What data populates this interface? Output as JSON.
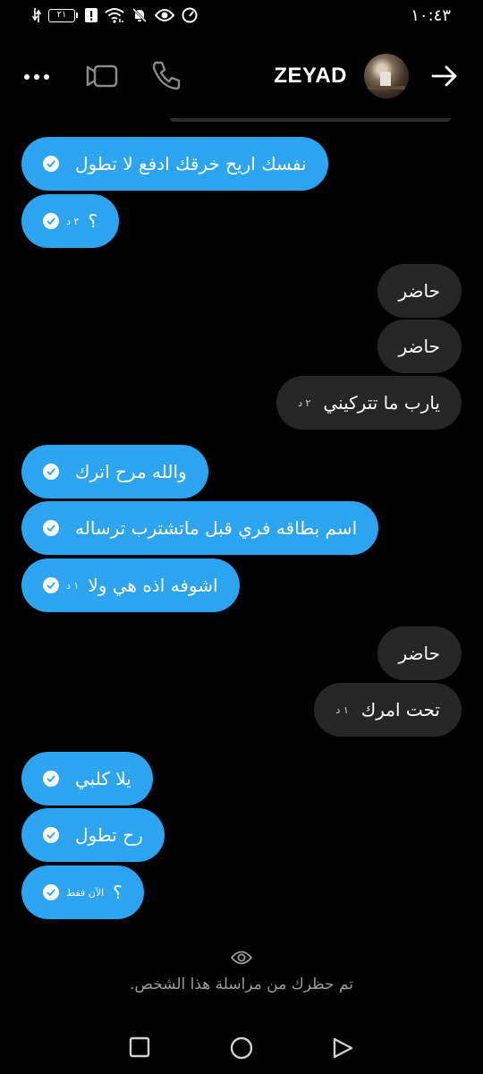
{
  "status_bar": {
    "time": "١٠:٤٣",
    "battery": "٢١",
    "icons": [
      "charging-arrows-icon",
      "battery-icon",
      "alert-icon",
      "wifi-icon",
      "muted-bell-icon",
      "eye-icon",
      "speedometer-icon"
    ]
  },
  "header": {
    "contact_name": "ZEYAD",
    "icons": [
      "more-icon",
      "video-call-icon",
      "voice-call-icon",
      "avatar",
      "back-arrow-icon"
    ]
  },
  "messages": [
    {
      "side": "sent",
      "text": "نفسك اريح خرقك ادفع لا تطول",
      "time": "",
      "read": true
    },
    {
      "side": "sent",
      "text": "؟",
      "time": "٢ د",
      "read": true
    },
    {
      "side": "received",
      "text": "حاضر",
      "time": ""
    },
    {
      "side": "received",
      "text": "حاضر",
      "time": ""
    },
    {
      "side": "received",
      "text": "يارب ما تتركيني",
      "time": "٢ د"
    },
    {
      "side": "sent",
      "text": "والله مرح اترك",
      "time": "",
      "read": true
    },
    {
      "side": "sent",
      "text": "اسم بطاقه فري قبل ماتشترب ترساله",
      "time": "",
      "read": true
    },
    {
      "side": "sent",
      "text": "اشوفه اذه هي ولا",
      "time": "١ د",
      "read": true
    },
    {
      "side": "received",
      "text": "حاضر",
      "time": ""
    },
    {
      "side": "received",
      "text": "تحت امرك",
      "time": "١ د"
    },
    {
      "side": "sent",
      "text": "يلا كلبي",
      "time": "",
      "read": true
    },
    {
      "side": "sent",
      "text": "رح تطول",
      "time": "",
      "read": true
    },
    {
      "side": "sent",
      "text": "؟",
      "time": "الآن فقط",
      "read": true
    }
  ],
  "blocked_notice": "تم حظرك من مراسلة هذا الشخص.",
  "colors": {
    "sent_bubble": "#2da4f0",
    "received_bubble": "#262626",
    "background": "#000000"
  }
}
